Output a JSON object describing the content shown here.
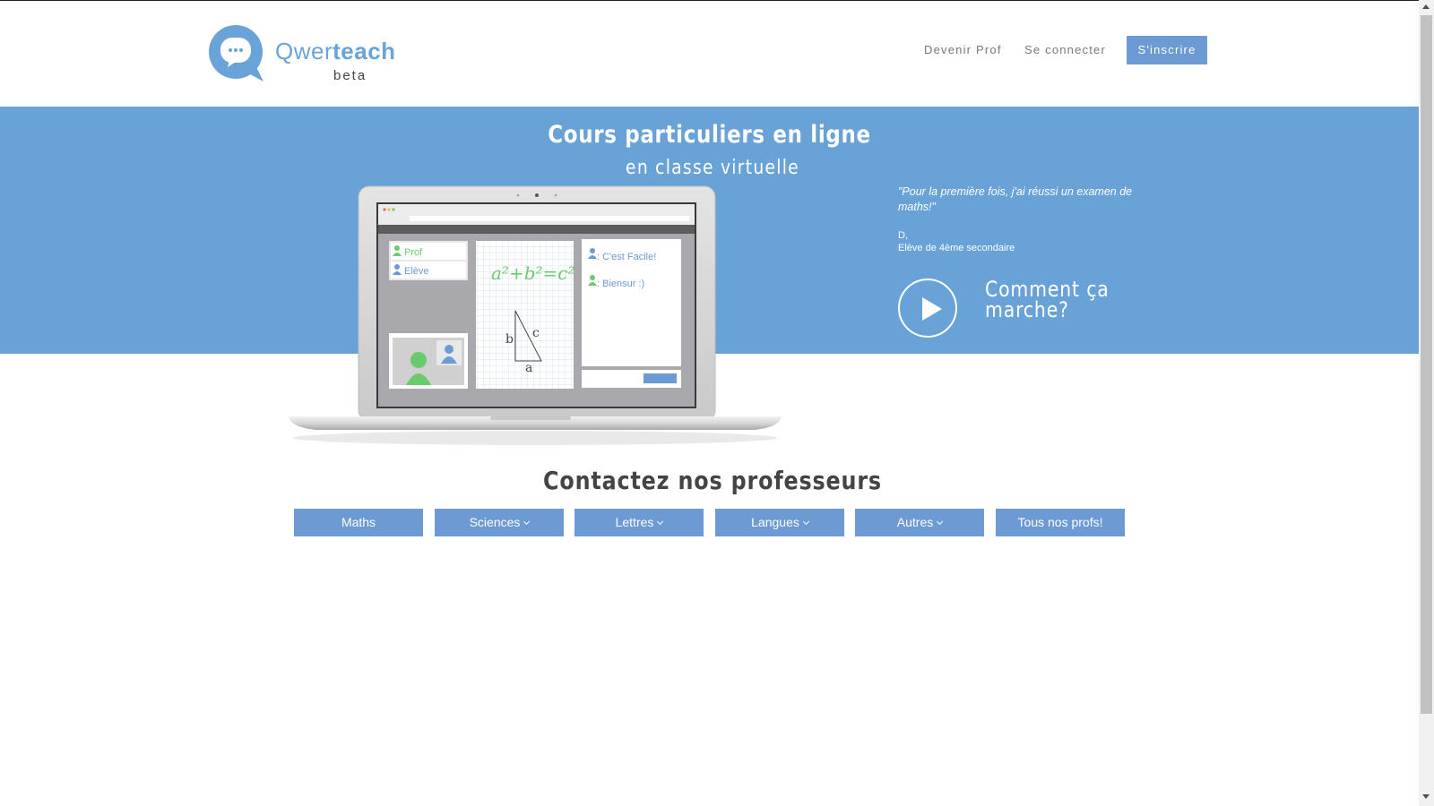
{
  "header": {
    "logo_text_light": "Qwer",
    "logo_text_bold": "teach",
    "logo_beta": "beta",
    "nav": {
      "become_teacher": "Devenir Prof",
      "login": "Se connecter",
      "signup": "S'inscrire"
    }
  },
  "hero": {
    "title": "Cours particuliers en ligne",
    "subtitle": "en classe virtuelle",
    "quote": "\"Pour la première fois, j'ai réussi un examen de maths!\"",
    "author_name": "D,",
    "author_role": "Elève de 4ème secondaire",
    "how_it_works": "Comment ça marche?",
    "laptop": {
      "user_prof": "Prof",
      "user_eleve": "Elève",
      "formula": "a²+b²=c²",
      "side_b": "b",
      "side_c": "c",
      "side_a": "a",
      "chat_1": ": C'est Facile!",
      "chat_2": ": Biensur :)"
    }
  },
  "contact": {
    "title": "Contactez nos professeurs",
    "categories": [
      {
        "label": "Maths",
        "dropdown": false
      },
      {
        "label": "Sciences",
        "dropdown": true
      },
      {
        "label": "Lettres",
        "dropdown": true
      },
      {
        "label": "Langues",
        "dropdown": true
      },
      {
        "label": "Autres",
        "dropdown": true
      },
      {
        "label": "Tous nos profs!",
        "dropdown": false
      }
    ]
  },
  "colors": {
    "brand_blue": "#69a2d7",
    "button_blue": "#6d9ad3",
    "accent_green": "#6acb6c"
  }
}
